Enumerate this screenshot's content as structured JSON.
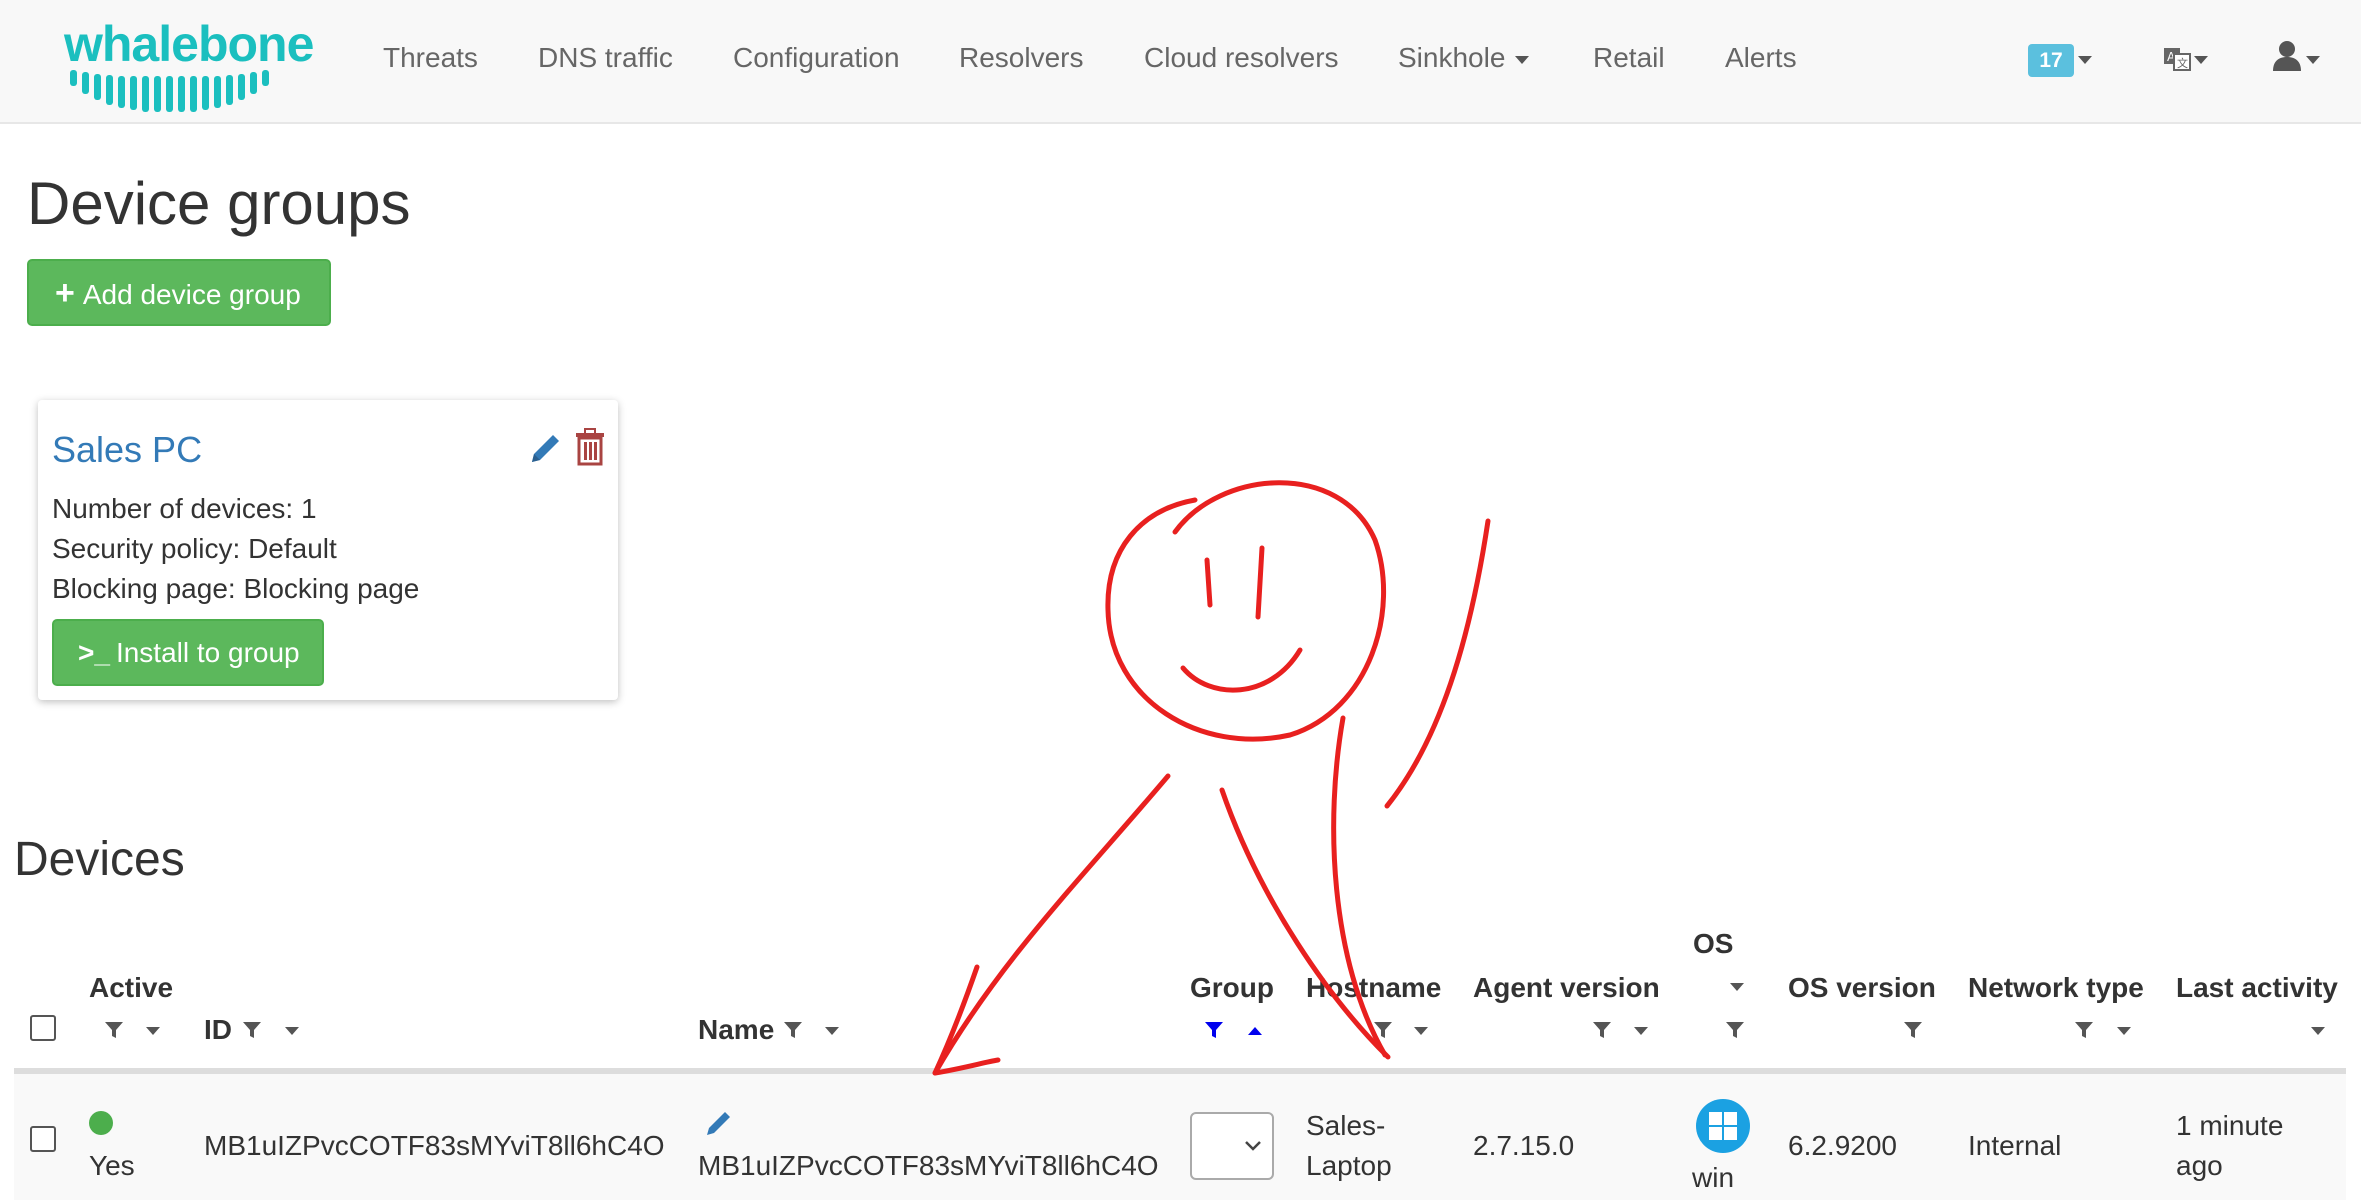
{
  "brand": {
    "logo_text": "whalebone",
    "accent": "#1bbfbf"
  },
  "nav": {
    "items": [
      "Threats",
      "DNS traffic",
      "Configuration",
      "Resolvers",
      "Cloud resolvers",
      "Sinkhole",
      "Retail",
      "Alerts"
    ],
    "notification_count": "17",
    "icons": [
      "language-icon",
      "user-icon"
    ]
  },
  "page": {
    "title": "Device groups",
    "add_button": "Add device group"
  },
  "group_card": {
    "title": "Sales PC",
    "devices_line": "Number of devices: 1",
    "policy_line": "Security policy: Default",
    "blocking_line": "Blocking page: Blocking page",
    "install_button": "Install to group"
  },
  "devices": {
    "title": "Devices",
    "columns": {
      "active": "Active",
      "id": "ID",
      "name": "Name",
      "group": "Group",
      "hostname": "Hostname",
      "agent_version": "Agent version",
      "os": "OS",
      "os_version": "OS version",
      "network_type": "Network type",
      "last_activity": "Last activity"
    },
    "rows": [
      {
        "active": "Yes",
        "id": "MB1uIZPvcCOTF83sMYviT8ll6hC4O",
        "name": "MB1uIZPvcCOTF83sMYviT8ll6hC4O",
        "group": "",
        "hostname_line1": "Sales-",
        "hostname_line2": "Laptop",
        "agent_version": "2.7.15.0",
        "os": "win",
        "os_version": "6.2.9200",
        "network_type": "Internal",
        "last_activity_line1": "1 minute",
        "last_activity_line2": "ago"
      }
    ]
  },
  "colors": {
    "success": "#5cb85c",
    "link": "#337ab7",
    "danger": "#a94442",
    "annotation": "#e8201f",
    "info_badge": "#5bc0de"
  }
}
